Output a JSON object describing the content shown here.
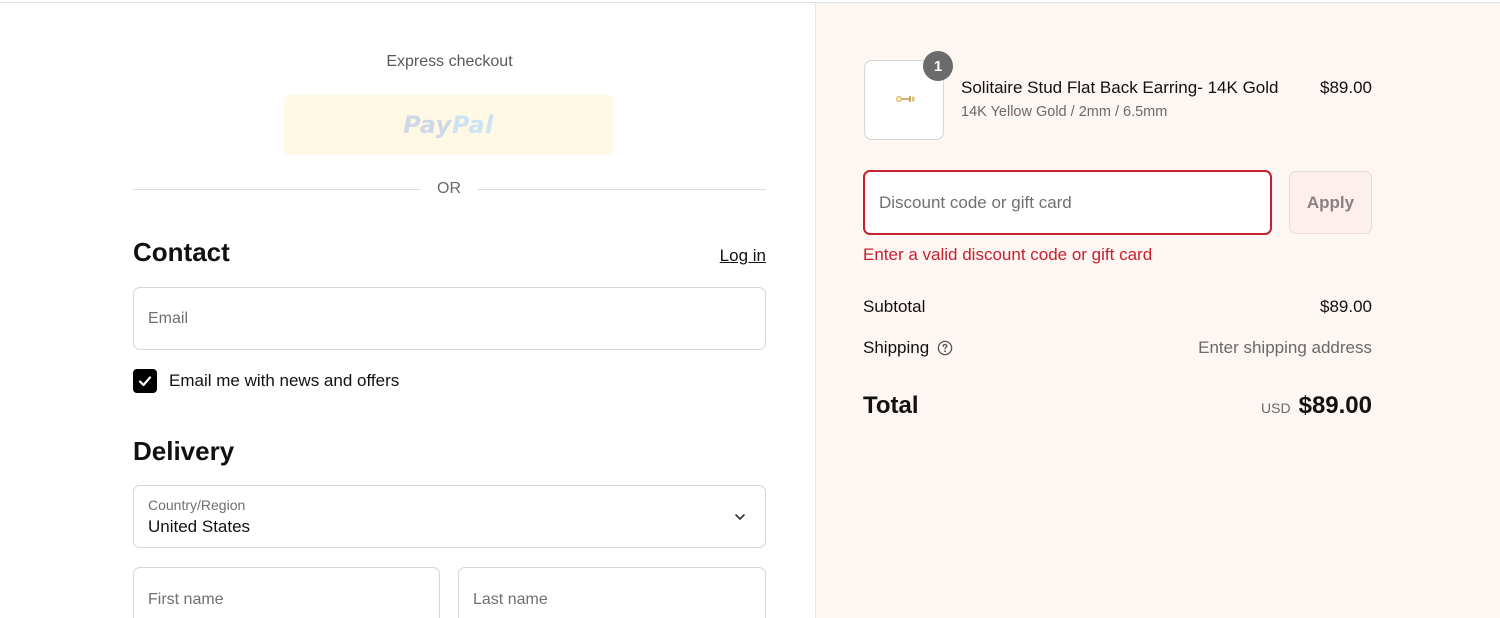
{
  "express_checkout": {
    "title": "Express checkout",
    "paypal_pay": "Pay",
    "paypal_pal": "Pal",
    "or_label": "OR"
  },
  "contact": {
    "title": "Contact",
    "login_label": "Log in",
    "email_placeholder": "Email",
    "newsletter_label": "Email me with news and offers",
    "newsletter_checked": true
  },
  "delivery": {
    "title": "Delivery",
    "country_label": "Country/Region",
    "country_value": "United States",
    "first_name_placeholder": "First name",
    "last_name_placeholder": "Last name"
  },
  "order_summary": {
    "product": {
      "quantity": "1",
      "name": "Solitaire Stud Flat Back Earring- 14K Gold",
      "variant": "14K Yellow Gold / 2mm / 6.5mm",
      "price": "$89.00"
    },
    "discount": {
      "placeholder": "Discount code or gift card",
      "value": "",
      "apply_label": "Apply",
      "error": "Enter a valid discount code or gift card"
    },
    "subtotal_label": "Subtotal",
    "subtotal_value": "$89.00",
    "shipping_label": "Shipping",
    "shipping_value": "Enter shipping address",
    "total_label": "Total",
    "currency": "USD",
    "total_value": "$89.00"
  },
  "colors": {
    "error": "#c8202f",
    "summary_bg": "#fdf6f3",
    "paypal_bg": "#fff8e5"
  },
  "icons": {
    "checkbox": "checkmark-icon",
    "country_select": "chevron-down-icon",
    "shipping_help": "question-circle-icon",
    "product": "earring-thumbnail"
  }
}
